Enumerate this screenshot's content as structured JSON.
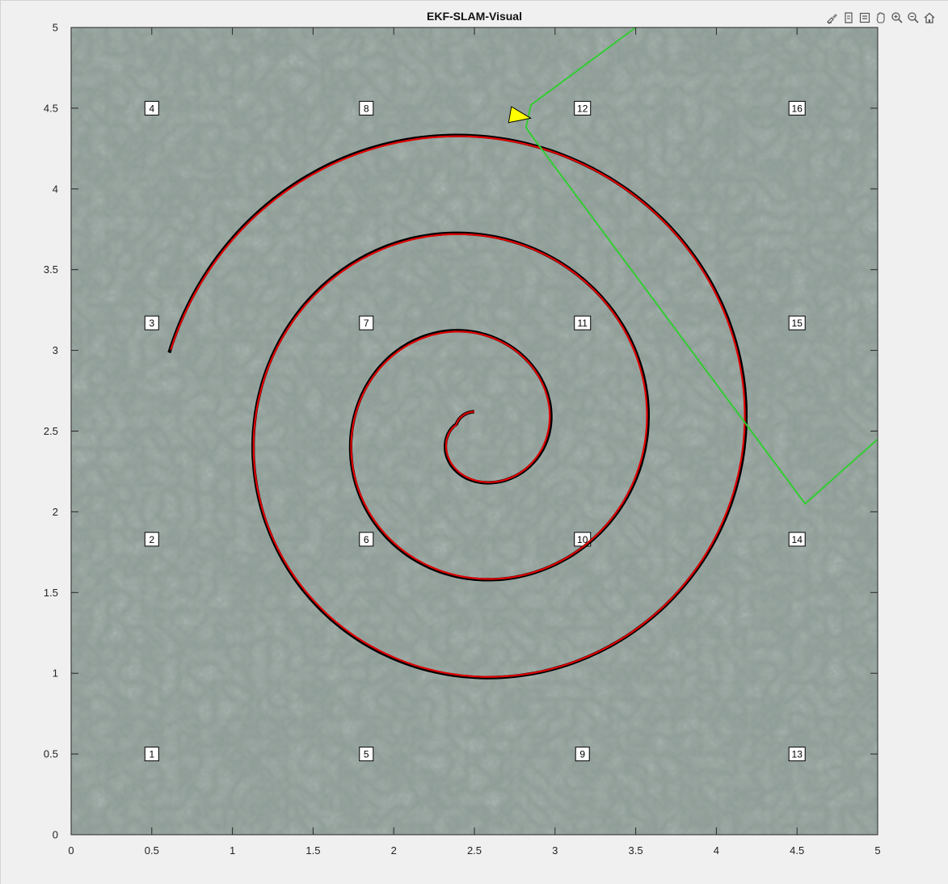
{
  "toolbar": {
    "items": [
      {
        "name": "brush-icon"
      },
      {
        "name": "export-icon"
      },
      {
        "name": "legend-icon"
      },
      {
        "name": "pan-icon"
      },
      {
        "name": "zoom-in-icon"
      },
      {
        "name": "zoom-out-icon"
      },
      {
        "name": "home-icon"
      }
    ]
  },
  "chart_data": {
    "type": "line",
    "title": "EKF-SLAM-Visual",
    "xlabel": "",
    "ylabel": "",
    "xlim": [
      0,
      5
    ],
    "ylim": [
      0,
      5
    ],
    "xticks": [
      "0",
      "0.5",
      "1",
      "1.5",
      "2",
      "2.5",
      "3",
      "3.5",
      "4",
      "4.5",
      "5"
    ],
    "yticks": [
      "0",
      "0.5",
      "1",
      "1.5",
      "2",
      "2.5",
      "3",
      "3.5",
      "4",
      "4.5",
      "5"
    ],
    "grid": false,
    "background": "textured gray-green",
    "colors": {
      "true_path": "#000000",
      "estimated_path": "#e00000",
      "sensor_range": "#33cc33",
      "robot": "#ffff00"
    },
    "landmarks": [
      {
        "label": "1",
        "x": 0.5,
        "y": 0.5
      },
      {
        "label": "2",
        "x": 0.5,
        "y": 1.83
      },
      {
        "label": "3",
        "x": 0.5,
        "y": 3.17
      },
      {
        "label": "4",
        "x": 0.5,
        "y": 4.5
      },
      {
        "label": "5",
        "x": 1.83,
        "y": 0.5
      },
      {
        "label": "6",
        "x": 1.83,
        "y": 1.83
      },
      {
        "label": "7",
        "x": 1.83,
        "y": 3.17
      },
      {
        "label": "8",
        "x": 1.83,
        "y": 4.5
      },
      {
        "label": "9",
        "x": 3.17,
        "y": 0.5
      },
      {
        "label": "10",
        "x": 3.17,
        "y": 1.83
      },
      {
        "label": "11",
        "x": 3.17,
        "y": 3.17
      },
      {
        "label": "12",
        "x": 3.17,
        "y": 4.5
      },
      {
        "label": "13",
        "x": 4.5,
        "y": 0.5
      },
      {
        "label": "14",
        "x": 4.5,
        "y": 1.83
      },
      {
        "label": "15",
        "x": 4.5,
        "y": 3.17
      },
      {
        "label": "16",
        "x": 4.5,
        "y": 4.5
      }
    ],
    "spiral": {
      "center": [
        2.5,
        2.5
      ],
      "start_angle_deg": 0,
      "end_angle_deg": 1155,
      "radius_start": 0.0,
      "radius_end": 1.95
    },
    "robot_pose": {
      "x": 2.78,
      "y": 4.45,
      "heading_deg": -10
    },
    "sensor_range_polyline": {
      "x": [
        3.5,
        2.85,
        2.82,
        2.84,
        4.55,
        5.0
      ],
      "y": [
        5.0,
        4.52,
        4.38,
        4.35,
        2.05,
        2.45
      ]
    }
  }
}
